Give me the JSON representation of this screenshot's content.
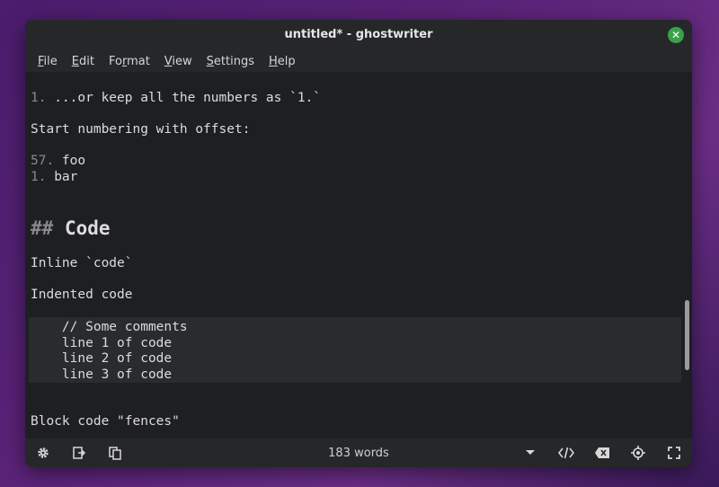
{
  "window": {
    "title": "untitled* - ghostwriter"
  },
  "menu": [
    {
      "pre": "",
      "u": "F",
      "post": "ile"
    },
    {
      "pre": "",
      "u": "E",
      "post": "dit"
    },
    {
      "pre": "Fo",
      "u": "r",
      "post": "mat"
    },
    {
      "pre": "",
      "u": "V",
      "post": "iew"
    },
    {
      "pre": "",
      "u": "S",
      "post": "ettings"
    },
    {
      "pre": "",
      "u": "H",
      "post": "elp"
    }
  ],
  "editor": {
    "line1_num": "1.",
    "line1_text": " ...or keep all the numbers as `1.`",
    "line2": "Start numbering with offset:",
    "line3_num": "57.",
    "line3_text": " foo",
    "line4_num": "1.",
    "line4_text": " bar",
    "heading_hash": "##",
    "heading_text": " Code",
    "inline": "Inline `code`",
    "indented": "Indented code",
    "code": [
      "    // Some comments",
      "    line 1 of code",
      "    line 2 of code",
      "    line 3 of code"
    ],
    "fences": "Block code \"fences\""
  },
  "status": {
    "word_count": "183 words"
  },
  "colors": {
    "accent_close": "#3aa14a"
  }
}
